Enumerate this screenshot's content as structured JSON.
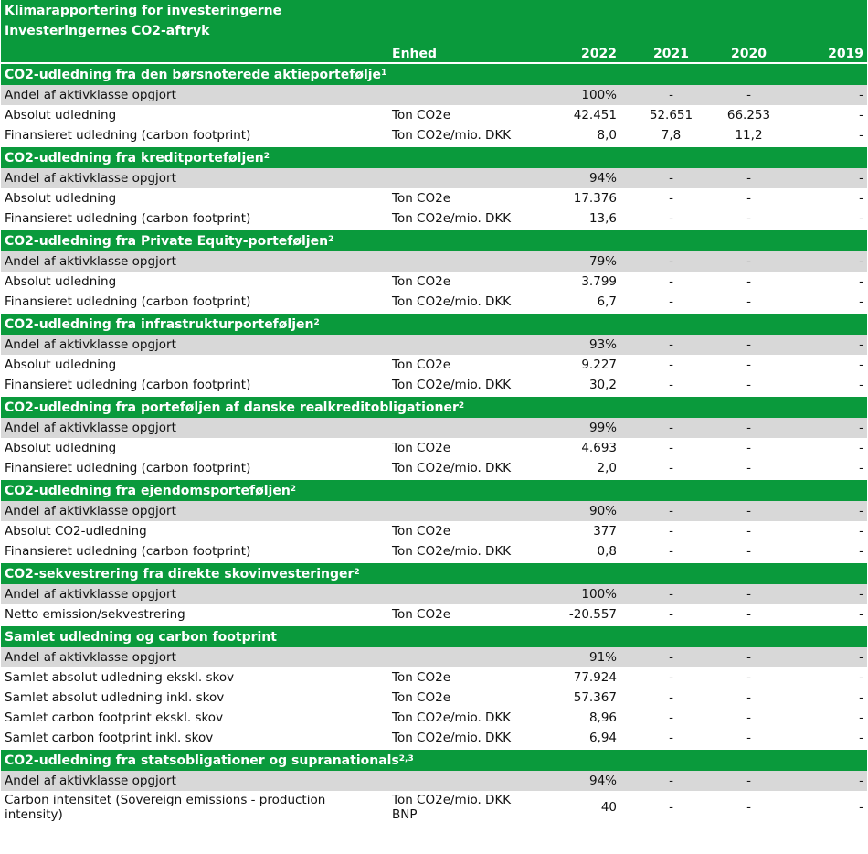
{
  "header": {
    "title": "Klimarapportering for investeringerne",
    "subtitle": "Investeringernes CO2-aftryk",
    "columns": {
      "unit": "Enhed",
      "y2022": "2022",
      "y2021": "2021",
      "y2020": "2020",
      "y2019": "2019"
    }
  },
  "colors": {
    "section_green": "#0a9a3c",
    "grey_row": "#d8d8d8"
  },
  "sections": [
    {
      "title": "CO2-udledning fra den børsnoterede aktieportefølje",
      "sup": "1",
      "rows": [
        {
          "label": "Andel af aktivklasse opgjort",
          "unit": "",
          "y2022": "100%",
          "y2021": "-",
          "y2020": "-",
          "y2019": "-",
          "grey": true
        },
        {
          "label": "Absolut udledning",
          "unit": "Ton CO2e",
          "y2022": "42.451",
          "y2021": "52.651",
          "y2020": "66.253",
          "y2019": "-",
          "grey": false
        },
        {
          "label": "Finansieret udledning (carbon footprint)",
          "unit": "Ton CO2e/mio. DKK",
          "y2022": "8,0",
          "y2021": "7,8",
          "y2020": "11,2",
          "y2019": "-",
          "grey": false
        }
      ]
    },
    {
      "title": "CO2-udledning fra kreditporteføljen",
      "sup": "2",
      "rows": [
        {
          "label": "Andel af aktivklasse opgjort",
          "unit": "",
          "y2022": "94%",
          "y2021": "-",
          "y2020": "-",
          "y2019": "-",
          "grey": true
        },
        {
          "label": "Absolut udledning",
          "unit": "Ton CO2e",
          "y2022": "17.376",
          "y2021": "-",
          "y2020": "-",
          "y2019": "-",
          "grey": false
        },
        {
          "label": "Finansieret udledning (carbon footprint)",
          "unit": "Ton CO2e/mio. DKK",
          "y2022": "13,6",
          "y2021": "-",
          "y2020": "-",
          "y2019": "-",
          "grey": false
        }
      ]
    },
    {
      "title": "CO2-udledning fra Private Equity-porteføljen",
      "sup": "2",
      "rows": [
        {
          "label": "Andel af aktivklasse opgjort",
          "unit": "",
          "y2022": "79%",
          "y2021": "-",
          "y2020": "-",
          "y2019": "-",
          "grey": true
        },
        {
          "label": "Absolut udledning",
          "unit": "Ton CO2e",
          "y2022": "3.799",
          "y2021": "-",
          "y2020": "-",
          "y2019": "-",
          "grey": false
        },
        {
          "label": "Finansieret udledning (carbon footprint)",
          "unit": "Ton CO2e/mio. DKK",
          "y2022": "6,7",
          "y2021": "-",
          "y2020": "-",
          "y2019": "-",
          "grey": false
        }
      ]
    },
    {
      "title": "CO2-udledning fra infrastrukturporteføljen",
      "sup": "2",
      "rows": [
        {
          "label": "Andel af aktivklasse opgjort",
          "unit": "",
          "y2022": "93%",
          "y2021": "-",
          "y2020": "-",
          "y2019": "-",
          "grey": true
        },
        {
          "label": "Absolut udledning",
          "unit": "Ton CO2e",
          "y2022": "9.227",
          "y2021": "-",
          "y2020": "-",
          "y2019": "-",
          "grey": false
        },
        {
          "label": "Finansieret udledning (carbon footprint)",
          "unit": "Ton CO2e/mio. DKK",
          "y2022": "30,2",
          "y2021": "-",
          "y2020": "-",
          "y2019": "-",
          "grey": false
        }
      ]
    },
    {
      "title": "CO2-udledning fra porteføljen af danske realkreditobligationer",
      "sup": "2",
      "rows": [
        {
          "label": "Andel af aktivklasse opgjort",
          "unit": "",
          "y2022": "99%",
          "y2021": "-",
          "y2020": "-",
          "y2019": "-",
          "grey": true
        },
        {
          "label": "Absolut udledning",
          "unit": "Ton CO2e",
          "y2022": "4.693",
          "y2021": "-",
          "y2020": "-",
          "y2019": "-",
          "grey": false
        },
        {
          "label": "Finansieret udledning (carbon footprint)",
          "unit": "Ton CO2e/mio. DKK",
          "y2022": "2,0",
          "y2021": "-",
          "y2020": "-",
          "y2019": "-",
          "grey": false
        }
      ]
    },
    {
      "title": "CO2-udledning fra ejendomsporteføljen",
      "sup": "2",
      "rows": [
        {
          "label": "Andel af aktivklasse opgjort",
          "unit": "",
          "y2022": "90%",
          "y2021": "-",
          "y2020": "-",
          "y2019": "-",
          "grey": true
        },
        {
          "label": "Absolut CO2-udledning",
          "unit": "Ton CO2e",
          "y2022": "377",
          "y2021": "-",
          "y2020": "-",
          "y2019": "-",
          "grey": false
        },
        {
          "label": "Finansieret udledning (carbon footprint)",
          "unit": "Ton CO2e/mio. DKK",
          "y2022": "0,8",
          "y2021": "-",
          "y2020": "-",
          "y2019": "-",
          "grey": false
        }
      ]
    },
    {
      "title": "CO2-sekvestrering fra direkte skovinvesteringer",
      "sup": "2",
      "rows": [
        {
          "label": "Andel af aktivklasse opgjort",
          "unit": "",
          "y2022": "100%",
          "y2021": "-",
          "y2020": "-",
          "y2019": "-",
          "grey": true
        },
        {
          "label": "Netto emission/sekvestrering",
          "unit": "Ton CO2e",
          "y2022": "-20.557",
          "y2021": "-",
          "y2020": "-",
          "y2019": "-",
          "grey": false
        }
      ]
    },
    {
      "title": "Samlet udledning og carbon footprint",
      "sup": "",
      "rows": [
        {
          "label": "Andel af aktivklasse opgjort",
          "unit": "",
          "y2022": "91%",
          "y2021": "-",
          "y2020": "-",
          "y2019": "-",
          "grey": true
        },
        {
          "label": "Samlet absolut udledning ekskl. skov",
          "unit": "Ton CO2e",
          "y2022": "77.924",
          "y2021": "-",
          "y2020": "-",
          "y2019": "-",
          "grey": false
        },
        {
          "label": "Samlet absolut udledning inkl. skov",
          "unit": "Ton CO2e",
          "y2022": "57.367",
          "y2021": "-",
          "y2020": "-",
          "y2019": "-",
          "grey": false
        },
        {
          "label": "Samlet carbon footprint ekskl. skov",
          "unit": "Ton CO2e/mio. DKK",
          "y2022": "8,96",
          "y2021": "-",
          "y2020": "-",
          "y2019": "-",
          "grey": false
        },
        {
          "label": "Samlet carbon footprint inkl. skov",
          "unit": "Ton CO2e/mio. DKK",
          "y2022": "6,94",
          "y2021": "-",
          "y2020": "-",
          "y2019": "-",
          "grey": false
        }
      ]
    },
    {
      "title": "CO2-udledning fra statsobligationer og supranationals",
      "sup": "2,3",
      "rows": [
        {
          "label": "Andel af aktivklasse opgjort",
          "unit": "",
          "y2022": "94%",
          "y2021": "-",
          "y2020": "-",
          "y2019": "-",
          "grey": true
        },
        {
          "label": "Carbon intensitet (Sovereign emissions - production intensity)",
          "unit": "Ton CO2e/mio. DKK BNP",
          "y2022": "40",
          "y2021": "-",
          "y2020": "-",
          "y2019": "-",
          "grey": false,
          "tall": true
        }
      ]
    }
  ]
}
